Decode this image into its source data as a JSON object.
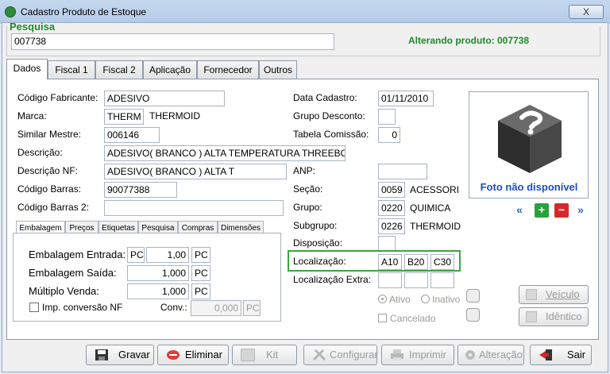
{
  "window": {
    "title": "Cadastro Produto de Estoque",
    "close_label": "X"
  },
  "search": {
    "label": "Pesquisa",
    "value": "007738",
    "status": "Alterando produto: 007738"
  },
  "tabs": [
    "Dados",
    "Fiscal 1",
    "Fiscal 2",
    "Aplicação",
    "Fornecedor",
    "Outros"
  ],
  "dados": {
    "codigo_fabricante": {
      "label": "Código Fabricante:",
      "value": "ADESIVO"
    },
    "marca": {
      "label": "Marca:",
      "code": "THERM",
      "name": "THERMOID"
    },
    "similar_mestre": {
      "label": "Similar Mestre:",
      "value": "006146"
    },
    "descricao": {
      "label": "Descrição:",
      "value": "ADESIVO( BRANCO ) ALTA TEMPERATURA THREEBOND"
    },
    "descricao_nf": {
      "label": "Descrição NF:",
      "value": "ADESIVO( BRANCO ) ALTA T"
    },
    "codigo_barras": {
      "label": "Código Barras:",
      "value": "90077388"
    },
    "codigo_barras2": {
      "label": "Código Barras 2:",
      "value": ""
    },
    "data_cadastro": {
      "label": "Data Cadastro:",
      "value": "01/11/2010"
    },
    "grupo_desconto": {
      "label": "Grupo Desconto:",
      "value": ""
    },
    "tabela_comissao": {
      "label": "Tabela Comissão:",
      "value": "0"
    },
    "anp": {
      "label": "ANP:",
      "value": ""
    },
    "secao": {
      "label": "Seção:",
      "code": "0059",
      "name": "ACESSORI"
    },
    "grupo": {
      "label": "Grupo:",
      "code": "0220",
      "name": "QUIMICA"
    },
    "subgrupo": {
      "label": "Subgrupo:",
      "code": "0226",
      "name": "THERMOID"
    },
    "disposicao": {
      "label": "Disposição:",
      "value": ""
    },
    "localizacao": {
      "label": "Localização:",
      "v1": "A10",
      "v2": "B20",
      "v3": "C30"
    },
    "localizacao_extra": {
      "label": "Localização Extra:"
    },
    "ativo": "Ativo",
    "inativo": "Inativo",
    "cancelado": "Cancelado",
    "photo_caption": "Foto não disponível",
    "veiculo": "Veículo",
    "identico": "Idêntico"
  },
  "subtabs": [
    "Embalagem",
    "Preços",
    "Etiquetas",
    "Pesquisa",
    "Compras",
    "Dimensões"
  ],
  "embalagem": {
    "entrada": {
      "label": "Embalagem Entrada:",
      "unit1": "PC",
      "qty": "1,00",
      "unit2": "PC"
    },
    "saida": {
      "label": "Embalagem Saída:",
      "qty": "1,000",
      "unit": "PC"
    },
    "multiplo": {
      "label": "Múltiplo Venda:",
      "qty": "1,000",
      "unit": "PC"
    },
    "imp_conversao": "Imp. conversão NF",
    "conv": {
      "label": "Conv.:",
      "value": "0,000",
      "unit": "PC"
    }
  },
  "buttons": {
    "gravar": "Gravar",
    "eliminar": "Eliminar",
    "kit": "Kit",
    "configurar": "Configurar",
    "imprimir": "Imprimir",
    "alteracao": "Alteração",
    "sair": "Sair"
  },
  "colors": {
    "accent_green": "#1e8c24",
    "highlight_border": "#3aa544",
    "nav_blue": "#2d62b8"
  }
}
